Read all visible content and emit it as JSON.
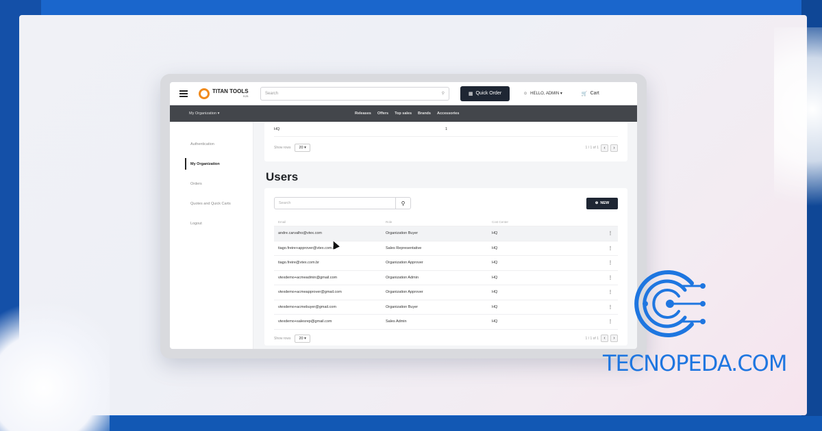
{
  "header": {
    "logo_text": "TITAN TOOLS",
    "logo_sub": "B2B",
    "search_placeholder": "Search",
    "quick_order_label": "Quick Order",
    "account_label": "HELLO, ADMIN ▾",
    "cart_label": "Cart"
  },
  "navbar": {
    "org_label": "My Organization ▾",
    "links": [
      "Releases",
      "Offers",
      "Top sales",
      "Brands",
      "Accessories"
    ]
  },
  "sidebar": {
    "items": [
      {
        "label": "Authentication",
        "active": false
      },
      {
        "label": "My Organization",
        "active": true
      },
      {
        "label": "Orders",
        "active": false
      },
      {
        "label": "Quotes and Quick Carts",
        "active": false
      },
      {
        "label": "Logout",
        "active": false
      }
    ]
  },
  "previous_section": {
    "row_name": "HQ",
    "row_value": "1",
    "show_rows_label": "Show rows",
    "rows_value": "20 ▾",
    "page_label": "1 / 1 of 1"
  },
  "users": {
    "title": "Users",
    "search_placeholder": "Search",
    "new_label": "NEW",
    "columns": [
      "Email",
      "Role",
      "Cost Center"
    ],
    "rows": [
      {
        "email": "andre.carvalho@vtex.com",
        "role": "Organization Buyer",
        "cost_center": "HQ"
      },
      {
        "email": "tiago.freire+approver@vtex.com.br",
        "role": "Sales Representative",
        "cost_center": "HQ"
      },
      {
        "email": "tiago.freire@vtex.com.br",
        "role": "Organization Approver",
        "cost_center": "HQ"
      },
      {
        "email": "vtexdemo+acmeadmin@gmail.com",
        "role": "Organization Admin",
        "cost_center": "HQ"
      },
      {
        "email": "vtexdemo+acmeapprover@gmail.com",
        "role": "Organization Approver",
        "cost_center": "HQ"
      },
      {
        "email": "vtexdemo+acmebuyer@gmail.com",
        "role": "Organization Buyer",
        "cost_center": "HQ"
      },
      {
        "email": "vtexdemo+salesrep@gmail.com",
        "role": "Sales Admin",
        "cost_center": "HQ"
      }
    ],
    "show_rows_label": "Show rows",
    "rows_value": "20 ▾",
    "page_label": "1 / 1 of 1"
  },
  "brand": {
    "text": "TECNOPEDA.COM",
    "color": "#1e76e0"
  },
  "colors": {
    "frame_blue": "#1a66cc",
    "dark_button": "#1e2633",
    "nav_gray": "#43464b"
  }
}
